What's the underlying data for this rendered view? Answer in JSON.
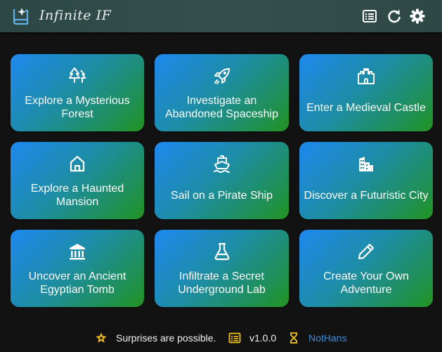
{
  "app": {
    "title": "Infinite IF"
  },
  "header": {
    "icons": [
      "book-sparkle-icon",
      "list-icon",
      "refresh-icon",
      "gear-icon"
    ]
  },
  "cards": [
    {
      "label": "Explore a Mysterious Forest",
      "icon": "trees-icon"
    },
    {
      "label": "Investigate an Abandoned Spaceship",
      "icon": "rocket-icon"
    },
    {
      "label": "Enter a Medieval Castle",
      "icon": "castle-icon"
    },
    {
      "label": "Explore a Haunted Mansion",
      "icon": "house-icon"
    },
    {
      "label": "Sail on a Pirate Ship",
      "icon": "ship-icon"
    },
    {
      "label": "Discover a Futuristic City",
      "icon": "city-icon"
    },
    {
      "label": "Uncover an Ancient Egyptian Tomb",
      "icon": "temple-icon"
    },
    {
      "label": "Infiltrate a Secret Underground Lab",
      "icon": "flask-icon"
    },
    {
      "label": "Create Your Own Adventure",
      "icon": "pencil-icon"
    }
  ],
  "footer": {
    "tagline": "Surprises are possible.",
    "version": "v1.0.0",
    "author": "NotHans"
  },
  "colors": {
    "header_bg": "#34504d",
    "card_gradient_start": "#1e88ef",
    "card_gradient_end": "#22931f",
    "author_link": "#3f8cd6",
    "star": "#f5c518"
  }
}
